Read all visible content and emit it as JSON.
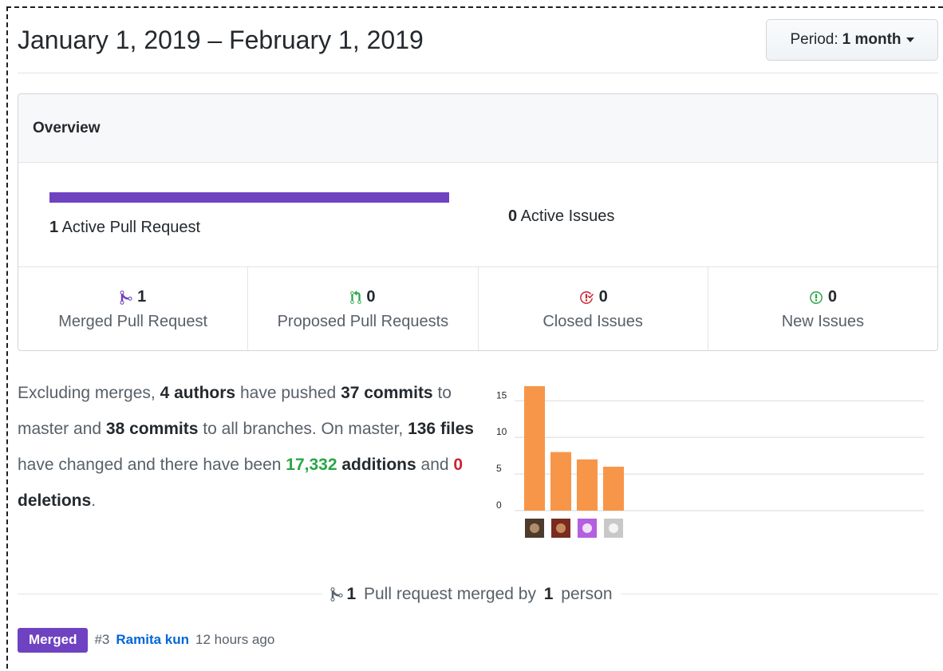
{
  "header": {
    "title": "January 1, 2019 – February 1, 2019",
    "period_label": "Period:",
    "period_value": "1 month"
  },
  "overview": {
    "heading": "Overview",
    "active_pr_count": "1",
    "active_pr_label": "Active Pull Request",
    "active_pr_fraction": 1.0,
    "active_issues_count": "0",
    "active_issues_label": "Active Issues",
    "stats": [
      {
        "icon": "git-merge-icon",
        "count": "1",
        "label": "Merged Pull Request",
        "color": "#6f42c1"
      },
      {
        "icon": "git-pull-request-icon",
        "count": "0",
        "label": "Proposed Pull Requests",
        "color": "#28a745"
      },
      {
        "icon": "issue-closed-icon",
        "count": "0",
        "label": "Closed Issues",
        "color": "#cb2431"
      },
      {
        "icon": "issue-opened-icon",
        "count": "0",
        "label": "New Issues",
        "color": "#28a745"
      }
    ]
  },
  "narrative": {
    "p1": "Excluding merges, ",
    "authors": "4 authors",
    "p2": " have pushed ",
    "commits_master": "37 commits",
    "p3": " to master and ",
    "commits_all": "38 commits",
    "p4": " to all branches. On master, ",
    "files": "136 files",
    "p5": " have changed and there have been ",
    "additions_num": "17,332",
    "additions_word": " additions",
    "p6": " and ",
    "deletions_num": "0",
    "deletions_word": " deletions",
    "p7": "."
  },
  "chart_data": {
    "type": "bar",
    "categories": [
      "author-1",
      "author-2",
      "author-3",
      "author-4"
    ],
    "values": [
      17,
      8,
      7,
      6
    ],
    "ylim": [
      0,
      17
    ],
    "yticks": [
      0,
      5,
      10,
      15
    ],
    "bar_color": "#f79649",
    "grid": true
  },
  "merged": {
    "count": "1",
    "text_mid": " Pull request merged by ",
    "persons": "1",
    "text_end": " person",
    "badge": "Merged",
    "number": "#3",
    "title": "Ramita kun",
    "time": "12 hours ago"
  }
}
